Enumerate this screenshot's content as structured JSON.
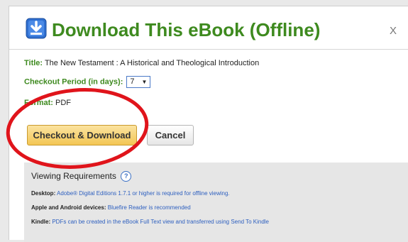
{
  "dialog": {
    "title": "Download This eBook (Offline)",
    "close_label": "X",
    "icon": "download-icon"
  },
  "fields": {
    "title_label": "Title:",
    "title_value": "The New Testament : A Historical and Theological Introduction",
    "checkout_label": "Checkout Period (in days):",
    "checkout_value": "7",
    "format_label": "Format:",
    "format_value": "PDF"
  },
  "buttons": {
    "checkout": "Checkout & Download",
    "cancel": "Cancel"
  },
  "requirements": {
    "title": "Viewing Requirements",
    "help": "?",
    "desktop_label": "Desktop:",
    "desktop_text": "Adobe® Digital Editions 1.7.1 or higher is required for offline viewing.",
    "apple_label": "Apple and Android devices:",
    "apple_text": "Bluefire Reader is recommended",
    "kindle_label": "Kindle:",
    "kindle_text": "PDFs can be created in the eBook Full Text view and transferred using Send To Kindle"
  },
  "colors": {
    "title_green": "#3e8a1f",
    "annotation_red": "#e0141b",
    "link_blue": "#2d5fbf"
  }
}
